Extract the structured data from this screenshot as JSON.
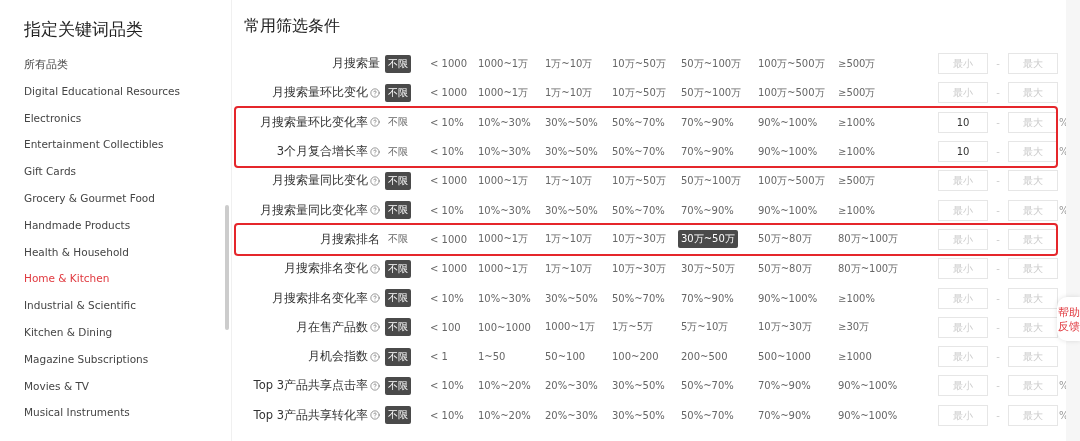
{
  "sidebar": {
    "title": "指定关键词品类",
    "items": [
      {
        "label": "所有品类",
        "selected": false
      },
      {
        "label": "Digital Educational Resources",
        "selected": false
      },
      {
        "label": "Electronics",
        "selected": false
      },
      {
        "label": "Entertainment Collectibles",
        "selected": false
      },
      {
        "label": "Gift Cards",
        "selected": false
      },
      {
        "label": "Grocery & Gourmet Food",
        "selected": false
      },
      {
        "label": "Handmade Products",
        "selected": false
      },
      {
        "label": "Health & Household",
        "selected": false
      },
      {
        "label": "Home & Kitchen",
        "selected": true
      },
      {
        "label": "Industrial & Scientific",
        "selected": false
      },
      {
        "label": "Kitchen & Dining",
        "selected": false
      },
      {
        "label": "Magazine Subscriptions",
        "selected": false
      },
      {
        "label": "Movies & TV",
        "selected": false
      },
      {
        "label": "Musical Instruments",
        "selected": false
      }
    ]
  },
  "main": {
    "title": "常用筛选条件",
    "sections": [
      {
        "highlighted": false,
        "rows": [
          {
            "label": "月搜索量",
            "help": false,
            "options": [
              {
                "label": "不限",
                "selected": true
              },
              {
                "label": "< 1000",
                "selected": false
              },
              {
                "label": "1000~1万",
                "selected": false
              },
              {
                "label": "1万~10万",
                "selected": false
              },
              {
                "label": "10万~50万",
                "selected": false
              },
              {
                "label": "50万~100万",
                "selected": false
              },
              {
                "label": "100万~500万",
                "selected": false
              },
              {
                "label": "≥500万",
                "selected": false
              }
            ],
            "min": {
              "placeholder": "最小"
            },
            "separator": "-",
            "max": {
              "placeholder": "最大"
            }
          },
          {
            "label": "月搜索量环比变化",
            "help": true,
            "options": [
              {
                "label": "不限",
                "selected": true
              },
              {
                "label": "< 1000",
                "selected": false
              },
              {
                "label": "1000~1万",
                "selected": false
              },
              {
                "label": "1万~10万",
                "selected": false
              },
              {
                "label": "10万~50万",
                "selected": false
              },
              {
                "label": "50万~100万",
                "selected": false
              },
              {
                "label": "100万~500万",
                "selected": false
              },
              {
                "label": "≥500万",
                "selected": false
              }
            ],
            "min": {
              "placeholder": "最小"
            },
            "separator": "-",
            "max": {
              "placeholder": "最大"
            }
          }
        ]
      },
      {
        "highlighted": true,
        "rows": [
          {
            "label": "月搜索量环比变化率",
            "help": true,
            "options": [
              {
                "label": "不限",
                "selected": false
              },
              {
                "label": "< 10%",
                "selected": false
              },
              {
                "label": "10%~30%",
                "selected": false
              },
              {
                "label": "30%~50%",
                "selected": false
              },
              {
                "label": "50%~70%",
                "selected": false
              },
              {
                "label": "70%~90%",
                "selected": false
              },
              {
                "label": "90%~100%",
                "selected": false
              },
              {
                "label": "≥100%",
                "selected": false
              }
            ],
            "min": {
              "value": "10"
            },
            "separator": "-",
            "max": {
              "placeholder": "最大"
            },
            "unit": "%"
          },
          {
            "label": "3个月复合增长率",
            "help": true,
            "options": [
              {
                "label": "不限",
                "selected": false
              },
              {
                "label": "< 10%",
                "selected": false
              },
              {
                "label": "10%~30%",
                "selected": false
              },
              {
                "label": "30%~50%",
                "selected": false
              },
              {
                "label": "50%~70%",
                "selected": false
              },
              {
                "label": "70%~90%",
                "selected": false
              },
              {
                "label": "90%~100%",
                "selected": false
              },
              {
                "label": "≥100%",
                "selected": false
              }
            ],
            "min": {
              "value": "10"
            },
            "separator": "-",
            "max": {
              "placeholder": "最大"
            },
            "unit": "%"
          }
        ]
      },
      {
        "highlighted": false,
        "rows": [
          {
            "label": "月搜索量同比变化",
            "help": true,
            "options": [
              {
                "label": "不限",
                "selected": true
              },
              {
                "label": "< 1000",
                "selected": false
              },
              {
                "label": "1000~1万",
                "selected": false
              },
              {
                "label": "1万~10万",
                "selected": false
              },
              {
                "label": "10万~50万",
                "selected": false
              },
              {
                "label": "50万~100万",
                "selected": false
              },
              {
                "label": "100万~500万",
                "selected": false
              },
              {
                "label": "≥500万",
                "selected": false
              }
            ],
            "min": {
              "placeholder": "最小"
            },
            "separator": "-",
            "max": {
              "placeholder": "最大"
            }
          },
          {
            "label": "月搜索量同比变化率",
            "help": true,
            "options": [
              {
                "label": "不限",
                "selected": true
              },
              {
                "label": "< 10%",
                "selected": false
              },
              {
                "label": "10%~30%",
                "selected": false
              },
              {
                "label": "30%~50%",
                "selected": false
              },
              {
                "label": "50%~70%",
                "selected": false
              },
              {
                "label": "70%~90%",
                "selected": false
              },
              {
                "label": "90%~100%",
                "selected": false
              },
              {
                "label": "≥100%",
                "selected": false
              }
            ],
            "min": {
              "placeholder": "最小"
            },
            "separator": "-",
            "max": {
              "placeholder": "最大"
            },
            "unit": "%"
          }
        ]
      },
      {
        "highlighted": true,
        "rows": [
          {
            "label": "月搜索排名",
            "help": false,
            "options": [
              {
                "label": "不限",
                "selected": false
              },
              {
                "label": "< 1000",
                "selected": false
              },
              {
                "label": "1000~1万",
                "selected": false
              },
              {
                "label": "1万~10万",
                "selected": false
              },
              {
                "label": "10万~30万",
                "selected": false
              },
              {
                "label": "30万~50万",
                "selected": true
              },
              {
                "label": "50万~80万",
                "selected": false
              },
              {
                "label": "80万~100万",
                "selected": false
              }
            ],
            "min": {
              "placeholder": "最小"
            },
            "separator": "-",
            "max": {
              "placeholder": "最大"
            }
          }
        ]
      },
      {
        "highlighted": false,
        "rows": [
          {
            "label": "月搜索排名变化",
            "help": true,
            "options": [
              {
                "label": "不限",
                "selected": true
              },
              {
                "label": "< 1000",
                "selected": false
              },
              {
                "label": "1000~1万",
                "selected": false
              },
              {
                "label": "1万~10万",
                "selected": false
              },
              {
                "label": "10万~30万",
                "selected": false
              },
              {
                "label": "30万~50万",
                "selected": false
              },
              {
                "label": "50万~80万",
                "selected": false
              },
              {
                "label": "80万~100万",
                "selected": false
              }
            ],
            "min": {
              "placeholder": "最小"
            },
            "separator": "-",
            "max": {
              "placeholder": "最大"
            }
          },
          {
            "label": "月搜索排名变化率",
            "help": true,
            "options": [
              {
                "label": "不限",
                "selected": true
              },
              {
                "label": "< 10%",
                "selected": false
              },
              {
                "label": "10%~30%",
                "selected": false
              },
              {
                "label": "30%~50%",
                "selected": false
              },
              {
                "label": "50%~70%",
                "selected": false
              },
              {
                "label": "70%~90%",
                "selected": false
              },
              {
                "label": "90%~100%",
                "selected": false
              },
              {
                "label": "≥100%",
                "selected": false
              }
            ],
            "min": {
              "placeholder": "最小"
            },
            "separator": "-",
            "max": {
              "placeholder": "最大"
            }
          },
          {
            "label": "月在售产品数",
            "help": true,
            "options": [
              {
                "label": "不限",
                "selected": true
              },
              {
                "label": "< 100",
                "selected": false
              },
              {
                "label": "100~1000",
                "selected": false
              },
              {
                "label": "1000~1万",
                "selected": false
              },
              {
                "label": "1万~5万",
                "selected": false
              },
              {
                "label": "5万~10万",
                "selected": false
              },
              {
                "label": "10万~30万",
                "selected": false
              },
              {
                "label": "≥30万",
                "selected": false
              }
            ],
            "min": {
              "placeholder": "最小"
            },
            "separator": "-",
            "max": {
              "placeholder": "最大"
            }
          },
          {
            "label": "月机会指数",
            "help": true,
            "options": [
              {
                "label": "不限",
                "selected": true
              },
              {
                "label": "< 1",
                "selected": false
              },
              {
                "label": "1~50",
                "selected": false
              },
              {
                "label": "50~100",
                "selected": false
              },
              {
                "label": "100~200",
                "selected": false
              },
              {
                "label": "200~500",
                "selected": false
              },
              {
                "label": "500~1000",
                "selected": false
              },
              {
                "label": "≥1000",
                "selected": false
              }
            ],
            "min": {
              "placeholder": "最小"
            },
            "separator": "-",
            "max": {
              "placeholder": "最大"
            }
          },
          {
            "label": "Top 3产品共享点击率",
            "help": true,
            "options": [
              {
                "label": "不限",
                "selected": true
              },
              {
                "label": "< 10%",
                "selected": false
              },
              {
                "label": "10%~20%",
                "selected": false
              },
              {
                "label": "20%~30%",
                "selected": false
              },
              {
                "label": "30%~50%",
                "selected": false
              },
              {
                "label": "50%~70%",
                "selected": false
              },
              {
                "label": "70%~90%",
                "selected": false
              },
              {
                "label": "90%~100%",
                "selected": false
              }
            ],
            "min": {
              "placeholder": "最小"
            },
            "separator": "-",
            "max": {
              "placeholder": "最大"
            },
            "unit": "%"
          },
          {
            "label": "Top 3产品共享转化率",
            "help": true,
            "options": [
              {
                "label": "不限",
                "selected": true
              },
              {
                "label": "< 10%",
                "selected": false
              },
              {
                "label": "10%~20%",
                "selected": false
              },
              {
                "label": "20%~30%",
                "selected": false
              },
              {
                "label": "30%~50%",
                "selected": false
              },
              {
                "label": "50%~70%",
                "selected": false
              },
              {
                "label": "70%~90%",
                "selected": false
              },
              {
                "label": "90%~100%",
                "selected": false
              }
            ],
            "min": {
              "placeholder": "最小"
            },
            "separator": "-",
            "max": {
              "placeholder": "最大"
            },
            "unit": "%"
          }
        ]
      }
    ]
  },
  "feedback_button": {
    "label": "帮助反馈"
  }
}
